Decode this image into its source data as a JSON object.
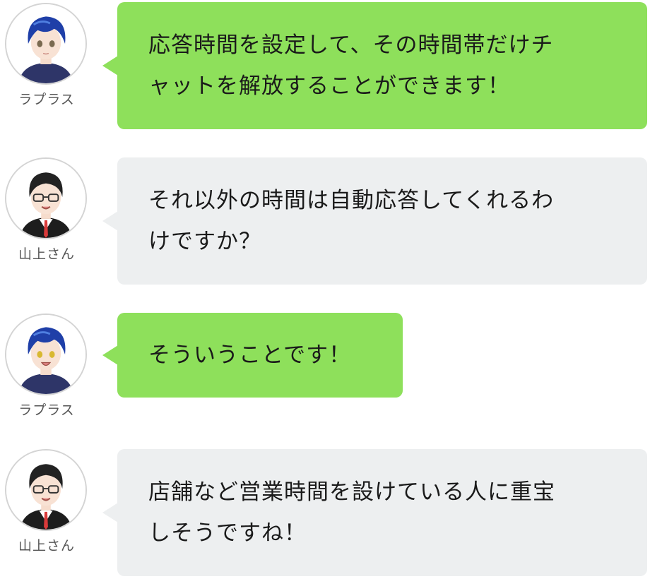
{
  "conversation": {
    "messages": [
      {
        "speaker": "ラプラス",
        "avatar": "laplace-avatar",
        "color": "#8ee05b",
        "text": "応答時間を設定して、その時間帯だけチ\nャットを解放することができます！"
      },
      {
        "speaker": "山上さん",
        "avatar": "yamagami-avatar",
        "color": "#edeff0",
        "text": "それ以外の時間は自動応答してくれるわ\nけですか？"
      },
      {
        "speaker": "ラプラス",
        "avatar": "laplace-avatar",
        "color": "#8ee05b",
        "text": "そういうことです！"
      },
      {
        "speaker": "山上さん",
        "avatar": "yamagami-avatar",
        "color": "#edeff0",
        "text": "店舗など営業時間を設けている人に重宝\nしそうですね！"
      }
    ]
  }
}
